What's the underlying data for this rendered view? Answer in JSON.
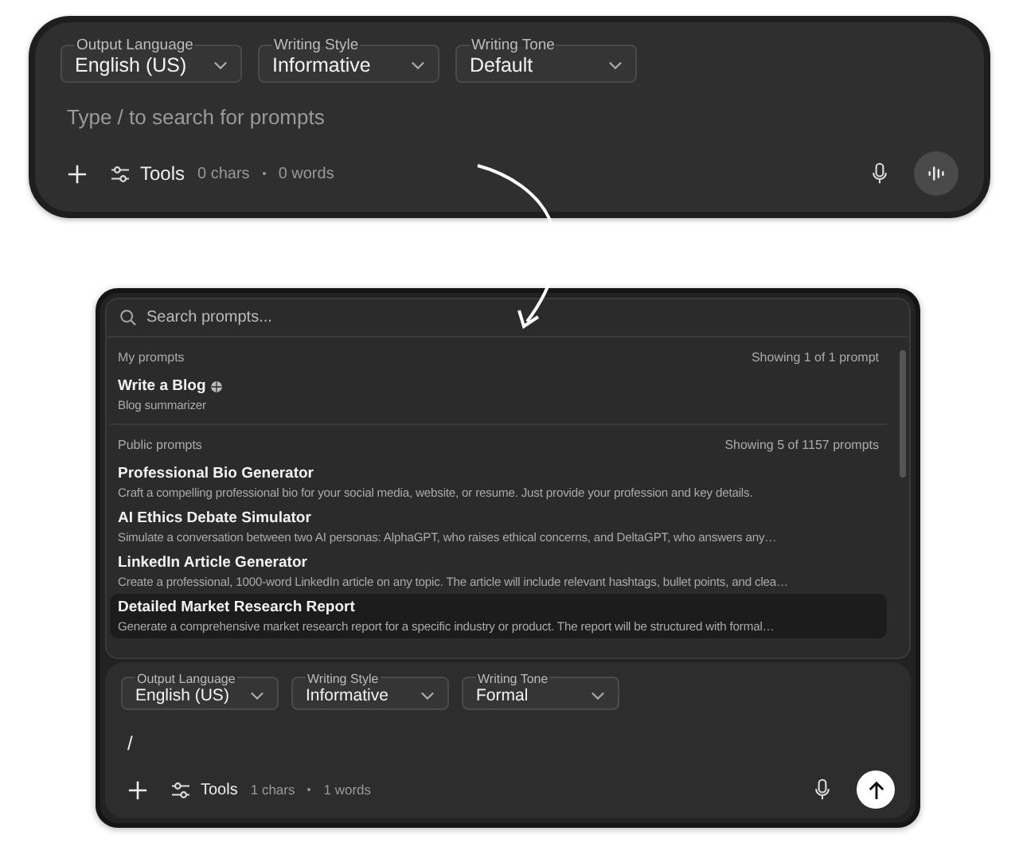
{
  "top_composer": {
    "selects": [
      {
        "label": "Output Language",
        "value": "English (US)"
      },
      {
        "label": "Writing Style",
        "value": "Informative"
      },
      {
        "label": "Writing Tone",
        "value": "Default"
      }
    ],
    "placeholder": "Type / to search for prompts",
    "tools": "Tools",
    "chars": "0 chars",
    "words": "0 words",
    "action": {
      "kind": "voice"
    }
  },
  "prompt_picker": {
    "search": {
      "placeholder": "Search prompts..."
    },
    "sections": [
      {
        "title": "My prompts",
        "count": "Showing 1 of 1 prompt",
        "items": [
          {
            "title": "Write a Blog",
            "description": "Blog summarizer",
            "shared": true,
            "selected": false
          }
        ]
      },
      {
        "title": "Public prompts",
        "count": "Showing 5 of 1157 prompts",
        "items": [
          {
            "title": "Professional Bio Generator",
            "description": "Craft a compelling professional bio for your social media, website, or resume. Just provide your profession and key details.",
            "shared": false,
            "selected": false
          },
          {
            "title": "AI Ethics Debate Simulator",
            "description": "Simulate a conversation between two AI personas: AlphaGPT, who raises ethical concerns, and DeltaGPT, who answers any…",
            "shared": false,
            "selected": false
          },
          {
            "title": "LinkedIn Article Generator",
            "description": "Create a professional, 1000-word LinkedIn article on any topic. The article will include relevant hashtags, bullet points, and clea…",
            "shared": false,
            "selected": false
          },
          {
            "title": "Detailed Market Research Report",
            "description": "Generate a comprehensive market research report for a specific industry or product. The report will be structured with formal…",
            "shared": false,
            "selected": true
          }
        ]
      }
    ]
  },
  "bottom_composer": {
    "selects": [
      {
        "label": "Output Language",
        "value": "English (US)"
      },
      {
        "label": "Writing Style",
        "value": "Informative"
      },
      {
        "label": "Writing Tone",
        "value": "Formal"
      }
    ],
    "value": "/",
    "tools": "Tools",
    "chars": "1 chars",
    "words": "1 words",
    "action": {
      "kind": "send"
    }
  }
}
